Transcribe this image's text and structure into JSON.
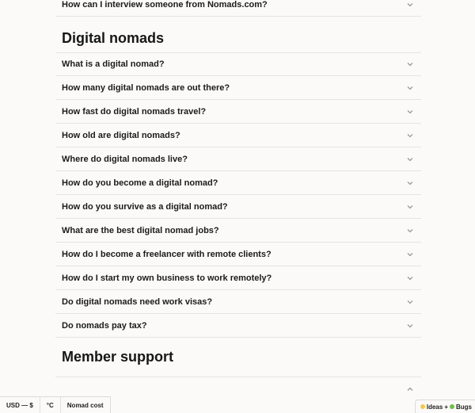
{
  "top_question": "How can I interview someone from Nomads.com?",
  "sections": {
    "digital_nomads": {
      "title": "Digital nomads",
      "questions": [
        "What is a digital nomad?",
        "How many digital nomads are out there?",
        "How fast do digital nomads travel?",
        "How old are digital nomads?",
        "Where do digital nomads live?",
        "How do you become a digital nomad?",
        "How do you survive as a digital nomad?",
        "What are the best digital nomad jobs?",
        "How do I become a freelancer with remote clients?",
        "How do I start my own business to work remotely?",
        "Do digital nomads need work visas?",
        "Do nomads pay tax?"
      ]
    },
    "member_support": {
      "title": "Member support"
    }
  },
  "bottom_bar": {
    "currency": "USD — $",
    "temperature": "°C",
    "nomad_cost": "Nomad cost"
  },
  "ideas_button": {
    "ideas": "Ideas",
    "plus": "+",
    "bugs": "Bugs"
  },
  "colors": {
    "background": "#fbfaf8",
    "divider": "#e6e4e0",
    "text": "#1b1b1b",
    "chevron": "#9a9a9a"
  },
  "icons": {
    "faq_toggle": "chevron-down-icon",
    "expanded_toggle": "chevron-up-icon"
  }
}
